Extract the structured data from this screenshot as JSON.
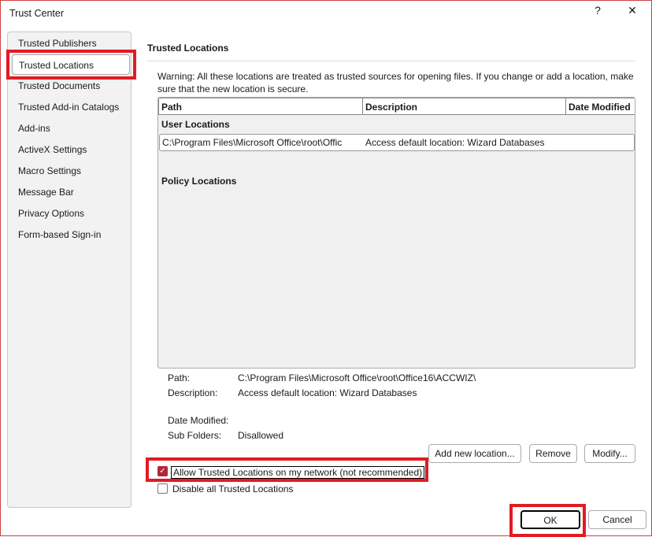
{
  "window": {
    "title": "Trust Center",
    "help": "?",
    "close": "✕"
  },
  "sidebar": {
    "items": [
      {
        "label": "Trusted Publishers"
      },
      {
        "label": "Trusted Locations",
        "selected": true
      },
      {
        "label": "Trusted Documents"
      },
      {
        "label": "Trusted Add-in Catalogs"
      },
      {
        "label": "Add-ins"
      },
      {
        "label": "ActiveX Settings"
      },
      {
        "label": "Macro Settings"
      },
      {
        "label": "Message Bar"
      },
      {
        "label": "Privacy Options"
      },
      {
        "label": "Form-based Sign-in"
      }
    ]
  },
  "main": {
    "heading": "Trusted Locations",
    "warning": "Warning: All these locations are treated as trusted sources for opening files.  If you change or add a location, make sure that the new location is secure.",
    "table": {
      "columns": [
        "Path",
        "Description",
        "Date Modified"
      ],
      "user_group": "User Locations",
      "rows": [
        {
          "path": "C:\\Program Files\\Microsoft Office\\root\\Offic",
          "description": "Access default location: Wizard Databases",
          "date": ""
        }
      ],
      "policy_group": "Policy Locations"
    },
    "details": {
      "path_label": "Path:",
      "path": "C:\\Program Files\\Microsoft Office\\root\\Office16\\ACCWIZ\\",
      "desc_label": "Description:",
      "desc": "Access default location: Wizard Databases",
      "date_label": "Date Modified:",
      "date": "",
      "sub_label": "Sub Folders:",
      "sub": "Disallowed"
    },
    "buttons": {
      "add": "Add new location...",
      "remove": "Remove",
      "modify": "Modify..."
    },
    "allow_network": {
      "label": "Allow Trusted Locations on my network (not recommended)",
      "checked": true
    },
    "disable_all": {
      "label": "Disable all Trusted Locations",
      "checked": false
    }
  },
  "footer": {
    "ok": "OK",
    "cancel": "Cancel"
  },
  "colors": {
    "highlight": "#e21b23",
    "checkbox": "#b3263a"
  }
}
